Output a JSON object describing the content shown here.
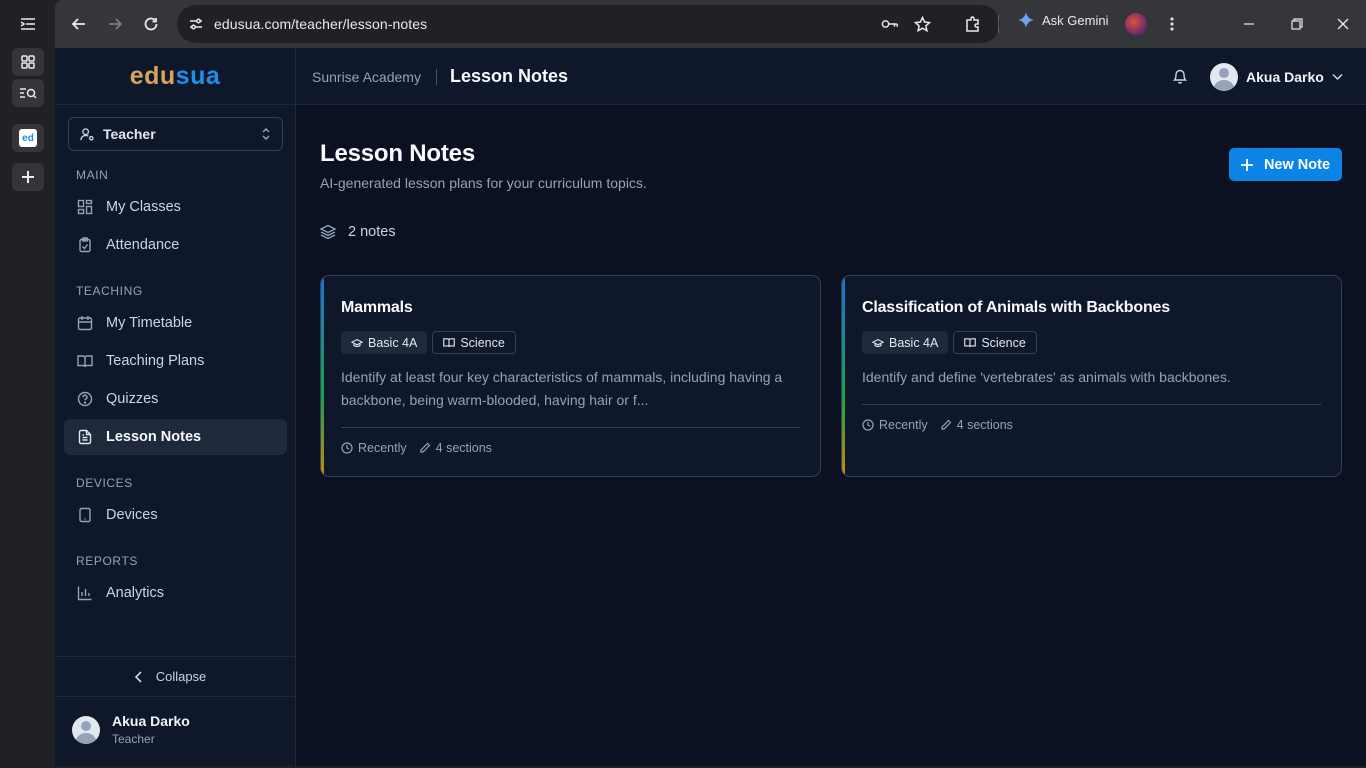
{
  "browser": {
    "url": "edusua.com/teacher/lesson-notes",
    "gemini_label": "Ask Gemini",
    "vertical_tab_favicon": "ed"
  },
  "brand": {
    "logo_part1": "edu",
    "logo_part2": "sua",
    "color_gold": "#d6a55b",
    "color_blue": "#1e90e8"
  },
  "sidebar": {
    "role_label": "Teacher",
    "sections": [
      {
        "label": "MAIN",
        "items": [
          {
            "label": "My Classes",
            "icon": "grid-icon"
          },
          {
            "label": "Attendance",
            "icon": "clipboard-check-icon"
          }
        ]
      },
      {
        "label": "TEACHING",
        "items": [
          {
            "label": "My Timetable",
            "icon": "calendar-icon"
          },
          {
            "label": "Teaching Plans",
            "icon": "book-open-icon"
          },
          {
            "label": "Quizzes",
            "icon": "help-circle-icon"
          },
          {
            "label": "Lesson Notes",
            "icon": "file-text-icon",
            "active": true
          }
        ]
      },
      {
        "label": "DEVICES",
        "items": [
          {
            "label": "Devices",
            "icon": "tablet-icon"
          }
        ]
      },
      {
        "label": "REPORTS",
        "items": [
          {
            "label": "Analytics",
            "icon": "bar-chart-icon"
          }
        ]
      }
    ],
    "collapse_label": "Collapse",
    "user": {
      "name": "Akua Darko",
      "role": "Teacher"
    }
  },
  "topbar": {
    "school": "Sunrise Academy",
    "page": "Lesson Notes",
    "user_name": "Akua Darko"
  },
  "main": {
    "title": "Lesson Notes",
    "subtitle": "AI-generated lesson plans for your curriculum topics.",
    "new_button": "New Note",
    "count_label": "2 notes",
    "accent_color": "#0b84e6"
  },
  "notes": [
    {
      "title": "Mammals",
      "class": "Basic 4A",
      "subject": "Science",
      "description": "Identify at least four key characteristics of mammals, including having a backbone, being warm-blooded, having hair or f...",
      "time": "Recently",
      "sections": "4 sections"
    },
    {
      "title": "Classification of Animals with Backbones",
      "class": "Basic 4A",
      "subject": "Science",
      "description": "Identify and define 'vertebrates' as animals with backbones.",
      "time": "Recently",
      "sections": "4 sections"
    }
  ]
}
